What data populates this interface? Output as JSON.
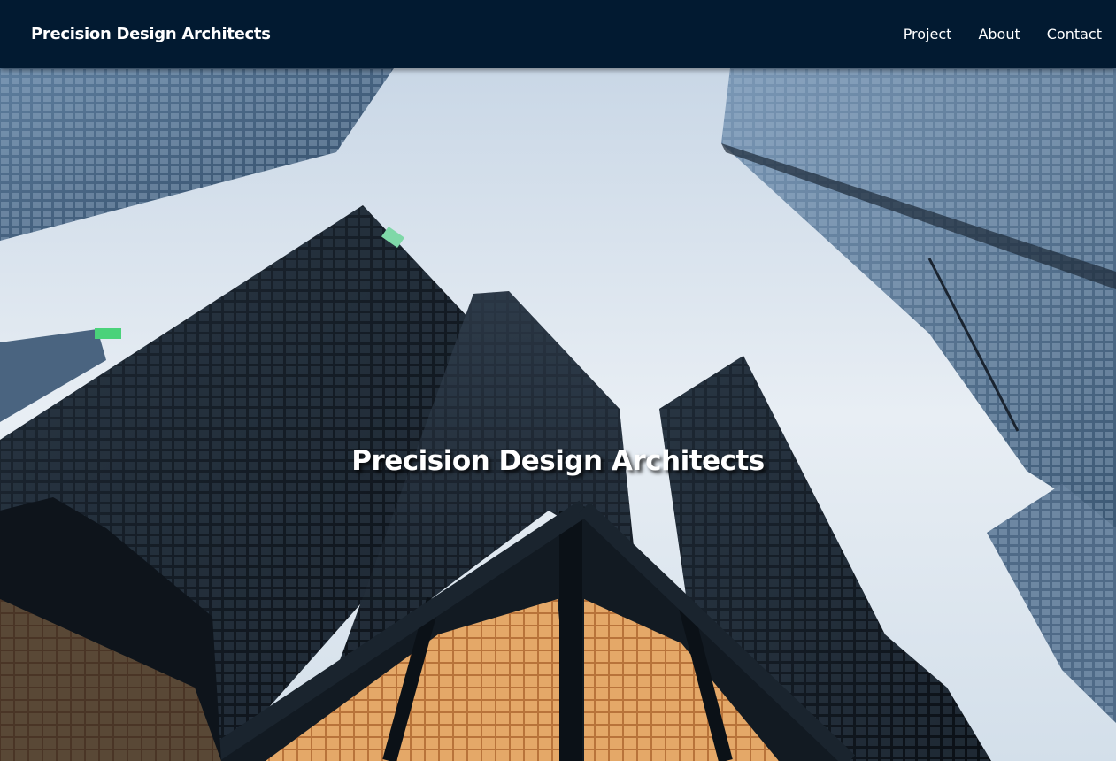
{
  "navbar": {
    "brand": "Precision Design Architects",
    "links": [
      "Project",
      "About",
      "Contact"
    ]
  },
  "hero": {
    "title": "Precision Design Architects",
    "image": "skyscrapers-looking-up-photo"
  },
  "colors": {
    "navbar_bg": "#021a31",
    "text": "#ffffff",
    "sky": "#dfe7f0",
    "glass_dark": "#111820",
    "lit_interior": "#c87a3a"
  }
}
